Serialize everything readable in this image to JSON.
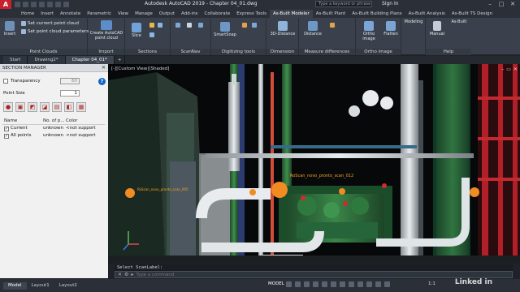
{
  "app": {
    "logo_letter": "A",
    "title": "Autodesk AutoCAD 2019 - Chapter 04_01.dwg",
    "search_placeholder": "Type a keyword or phrase",
    "signin": "Sign In"
  },
  "ribbon_tabs": [
    {
      "label": "Home"
    },
    {
      "label": "Insert"
    },
    {
      "label": "Annotate"
    },
    {
      "label": "Parametric"
    },
    {
      "label": "View"
    },
    {
      "label": "Manage"
    },
    {
      "label": "Output"
    },
    {
      "label": "Add-ins"
    },
    {
      "label": "Collaborate"
    },
    {
      "label": "Express Tools"
    },
    {
      "label": "As-Built Modeler"
    },
    {
      "label": "As-Built Plant"
    },
    {
      "label": "As-Built Building Plans"
    },
    {
      "label": "As-Built Analysis"
    },
    {
      "label": "As-Built TS Design"
    }
  ],
  "ribbon": {
    "insert": "Insert",
    "set_current": "Set current point cloud",
    "set_params": "Set point cloud parameters",
    "point_clouds_panel": "Point Clouds",
    "create_cloud": "Create AutoCAD point cloud",
    "import_panel": "Import",
    "slice": "Slice",
    "sections_panel": "Sections",
    "scannav_panel": "ScanNav",
    "smartsnap": "SmartSnap",
    "digitizing_panel": "Digitizing tools",
    "distance3d": "3D-Distance",
    "dimension_panel": "Dimension",
    "distance": "Distance",
    "measure_panel": "Measure differences",
    "ortho": "Ortho image",
    "flatten": "Flatten",
    "ortho_panel": "Ortho image",
    "modeling": "Modeling",
    "manual": "Manual",
    "asbuilt": "As-Built",
    "help_panel": "Help"
  },
  "doc_tabs": [
    {
      "label": "Start",
      "active": false
    },
    {
      "label": "Drawing2*",
      "active": false
    },
    {
      "label": "Chapter 04_01*",
      "active": true
    }
  ],
  "section_manager": {
    "title": "SECTION MANAGER",
    "transparency_label": "Transparency",
    "transparency_value": "60",
    "point_size_label": "Point Size",
    "point_size_value": "1",
    "columns": [
      "Name",
      "No. of p...",
      "Color"
    ],
    "rows": [
      {
        "name": "Current",
        "count": "unknown",
        "color": "<not support"
      },
      {
        "name": "All points",
        "count": "unknown",
        "color": "<not support"
      }
    ]
  },
  "viewport": {
    "label": "[-][Custom View][Shaded]",
    "scan_label_main": "RoScan_novo_pronto_scan_012",
    "scan_label_left": "RoScan_novo_pronto_scan_005"
  },
  "command": {
    "history": "Select ScanLabel:",
    "placeholder": "Type a command"
  },
  "layout_tabs": [
    {
      "label": "Model",
      "active": true
    },
    {
      "label": "Layout1",
      "active": false
    },
    {
      "label": "Layout2",
      "active": false
    }
  ],
  "status": {
    "model": "MODEL",
    "zoom": "1:1",
    "watermark": "Linked in"
  }
}
